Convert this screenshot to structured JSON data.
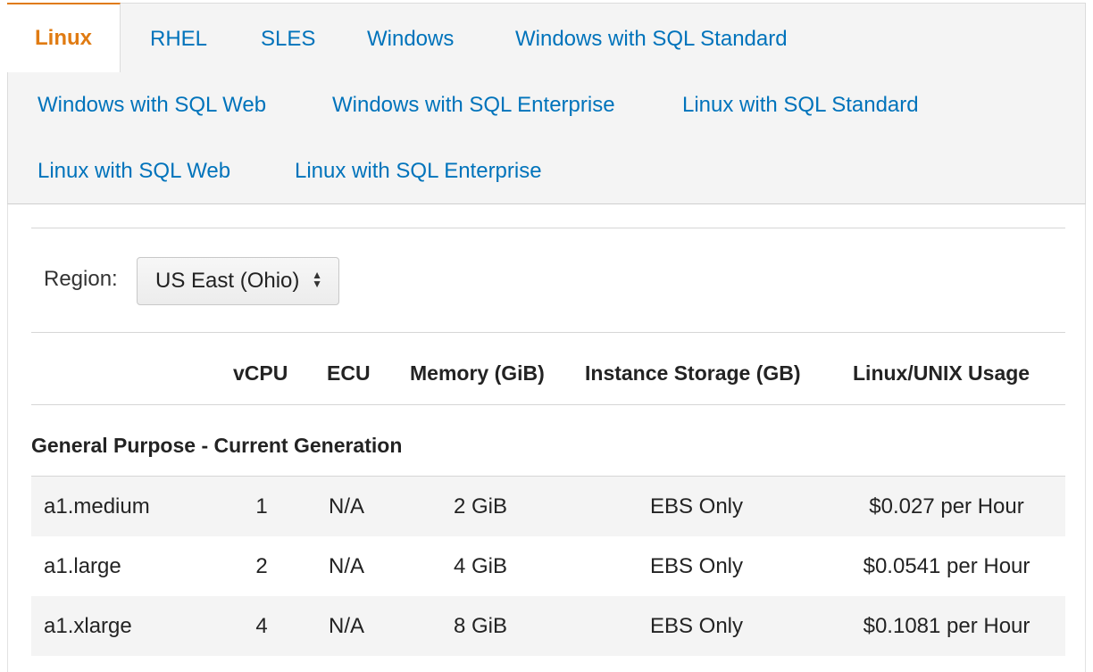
{
  "tabs": [
    {
      "label": "Linux",
      "active": true
    },
    {
      "label": "RHEL"
    },
    {
      "label": "SLES"
    },
    {
      "label": "Windows"
    },
    {
      "label": "Windows with SQL Standard"
    },
    {
      "label": "Windows with SQL Web"
    },
    {
      "label": "Windows with SQL Enterprise"
    },
    {
      "label": "Linux with SQL Standard"
    },
    {
      "label": "Linux with SQL Web"
    },
    {
      "label": "Linux with SQL Enterprise"
    }
  ],
  "region": {
    "label": "Region:",
    "selected": "US East (Ohio)"
  },
  "table": {
    "headers": [
      "vCPU",
      "ECU",
      "Memory (GiB)",
      "Instance Storage (GB)",
      "Linux/UNIX Usage"
    ],
    "section_title": "General Purpose - Current Generation",
    "rows": [
      {
        "instance": "a1.medium",
        "vcpu": "1",
        "ecu": "N/A",
        "memory": "2 GiB",
        "storage": "EBS Only",
        "price": "$0.027 per Hour"
      },
      {
        "instance": "a1.large",
        "vcpu": "2",
        "ecu": "N/A",
        "memory": "4 GiB",
        "storage": "EBS Only",
        "price": "$0.0541 per Hour"
      },
      {
        "instance": "a1.xlarge",
        "vcpu": "4",
        "ecu": "N/A",
        "memory": "8 GiB",
        "storage": "EBS Only",
        "price": "$0.1081 per Hour"
      }
    ]
  },
  "colors": {
    "link": "#0073bb",
    "active_tab": "#e07b12",
    "panel_bg": "#f4f4f4"
  }
}
